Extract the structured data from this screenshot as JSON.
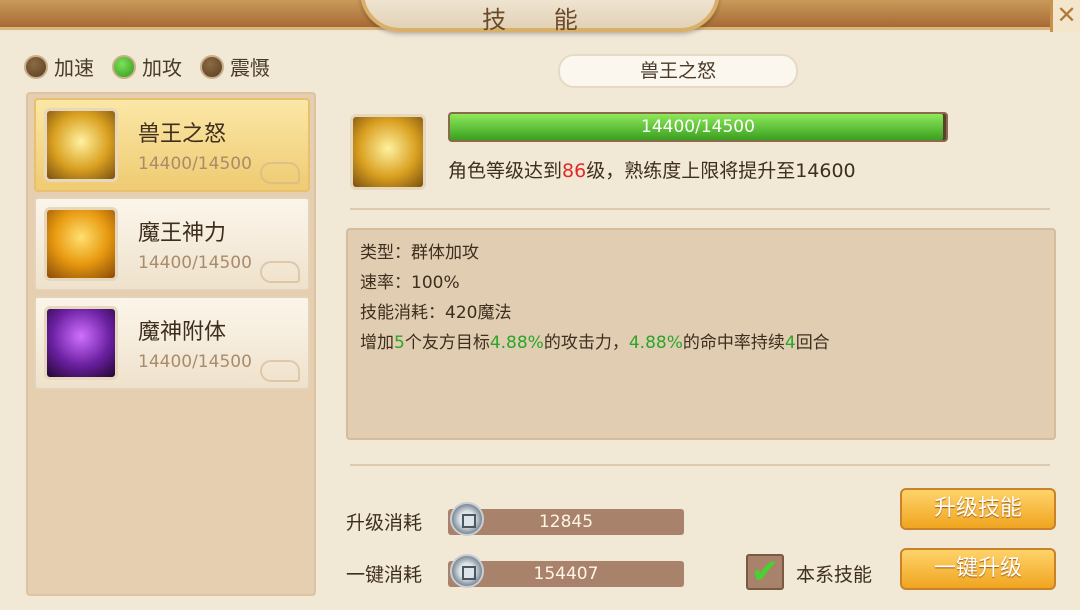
{
  "window": {
    "title": "技 能"
  },
  "tabs": [
    {
      "label": "加速",
      "selected": false
    },
    {
      "label": "加攻",
      "selected": true
    },
    {
      "label": "震慑",
      "selected": false
    }
  ],
  "skills": [
    {
      "name": "兽王之怒",
      "value": "14400/14500",
      "selected": true,
      "icon": "golden-beast-icon"
    },
    {
      "name": "魔王神力",
      "value": "14400/14500",
      "selected": false,
      "icon": "demon-power-icon"
    },
    {
      "name": "魔神附体",
      "value": "14400/14500",
      "selected": false,
      "icon": "demon-possession-icon"
    }
  ],
  "detail": {
    "name": "兽王之怒",
    "progress_text": "14400/14500",
    "progress_fraction": 0.993,
    "req_prefix": "角色等级达到",
    "req_level": "86",
    "req_suffix": "级，熟练度上限将提升至14600",
    "type_line": "类型：群体加攻",
    "rate_line": "速率：100%",
    "cost_line": "技能消耗：420魔法",
    "effect": {
      "p1": "增加",
      "n1": "5",
      "p2": "个友方目标",
      "n2": "4.88%",
      "p3": "的攻击力，",
      "n3": "4.88%",
      "p4": "的命中率持续",
      "n4": "4",
      "p5": "回合"
    }
  },
  "costs": {
    "upgrade_label": "升级消耗",
    "upgrade_value": "12845",
    "oneclick_label": "一键消耗",
    "oneclick_value": "154407"
  },
  "buttons": {
    "upgrade": "升级技能",
    "oneclick": "一键升级"
  },
  "checkbox": {
    "label": "本系技能",
    "checked": true
  },
  "colors": {
    "accent_green": "#3aa020",
    "highlight_red": "#e02a2a",
    "button_orange": "#f0a520"
  }
}
